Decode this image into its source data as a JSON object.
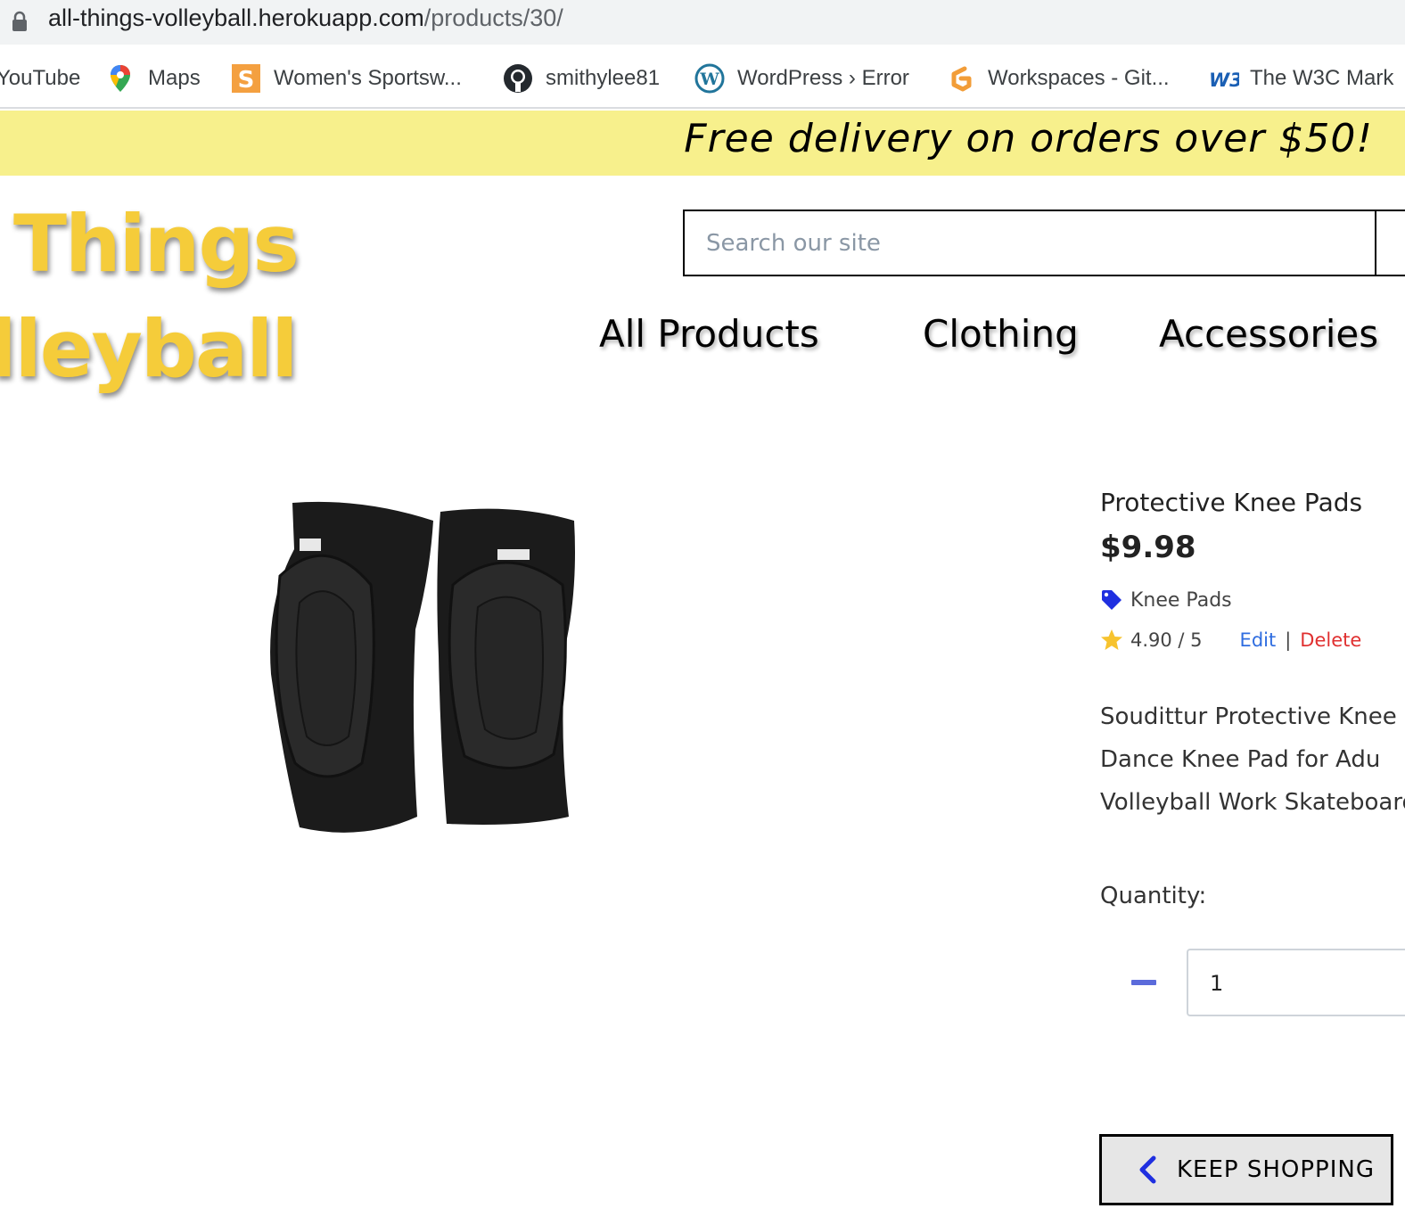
{
  "browser": {
    "url_host": "all-things-volleyball.herokuapp.com",
    "url_path": "/products/30/"
  },
  "bookmarks": [
    {
      "label": "YouTube",
      "icon": "youtube-icon"
    },
    {
      "label": "Maps",
      "icon": "maps-pin-icon"
    },
    {
      "label": "Women's Sportsw...",
      "icon": "sportswear-icon"
    },
    {
      "label": "smithylee81",
      "icon": "github-icon"
    },
    {
      "label": "WordPress › Error",
      "icon": "wordpress-icon"
    },
    {
      "label": "Workspaces - Git...",
      "icon": "gitpod-icon"
    },
    {
      "label": "The W3C Mark",
      "icon": "w3c-icon"
    }
  ],
  "banner": {
    "text": "Free delivery on orders over $50!",
    "color": "#f7f08c"
  },
  "logo": {
    "line1": "ll Things",
    "line2": "olleyball",
    "color": "#f5cc3a"
  },
  "search": {
    "placeholder": "Search our site"
  },
  "nav": {
    "items": [
      "All Products",
      "Clothing",
      "Accessories"
    ]
  },
  "product": {
    "title": "Protective Knee Pads",
    "price": "$9.98",
    "category": "Knee Pads",
    "rating": "4.90 / 5",
    "edit_label": "Edit",
    "separator": "|",
    "delete_label": "Delete",
    "description_lines": [
      "Soudittur Protective Knee",
      "Dance Knee Pad for Adu",
      "Volleyball Work Skateboard"
    ],
    "quantity_label": "Quantity:",
    "quantity_value": "1"
  },
  "actions": {
    "keep_shopping": "KEEP SHOPPING"
  },
  "colors": {
    "edit_link": "#2f6de0",
    "delete_link": "#e03030",
    "tag_icon": "#1f2fe0",
    "minus_button": "#5b6bdb"
  }
}
